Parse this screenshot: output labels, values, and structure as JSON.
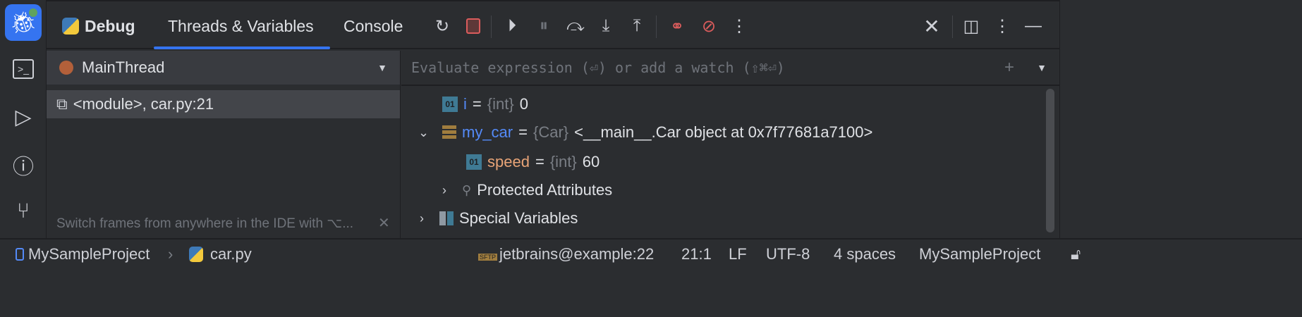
{
  "colors": {
    "accent": "#3574f0",
    "thread_dot": "#b3603a",
    "var_name": "#548af7",
    "field_name": "#e8a477"
  },
  "sidebar": {
    "icons": [
      "debug-icon",
      "terminal-icon",
      "run-icon",
      "problems-icon",
      "git-icon"
    ]
  },
  "header": {
    "title": "Debug",
    "tabs": [
      "Threads & Variables",
      "Console"
    ],
    "active_tab": 0
  },
  "threads": {
    "selected_thread": "MainThread",
    "frames": [
      "<module>, car.py:21"
    ],
    "hint": "Switch frames from anywhere in the IDE with ⌥..."
  },
  "variables": {
    "placeholder": "Evaluate expression (⏎) or add a watch (⇧⌘⏎)",
    "items": [
      {
        "name": "i",
        "type": "{int}",
        "value": "0"
      },
      {
        "name": "my_car",
        "type": "{Car}",
        "value": "<__main__.Car object at 0x7f77681a7100>"
      },
      {
        "name": "speed",
        "type": "{int}",
        "value": "60"
      },
      {
        "name": "Protected Attributes"
      },
      {
        "name": "Special Variables"
      }
    ]
  },
  "status": {
    "project": "MySampleProject",
    "file": "car.py",
    "remote": "jetbrains@example:22",
    "position": "21:1",
    "line_ending": "LF",
    "encoding": "UTF-8",
    "indent": "4 spaces",
    "interpreter": "MySampleProject",
    "sftp_label": "SFTP"
  }
}
